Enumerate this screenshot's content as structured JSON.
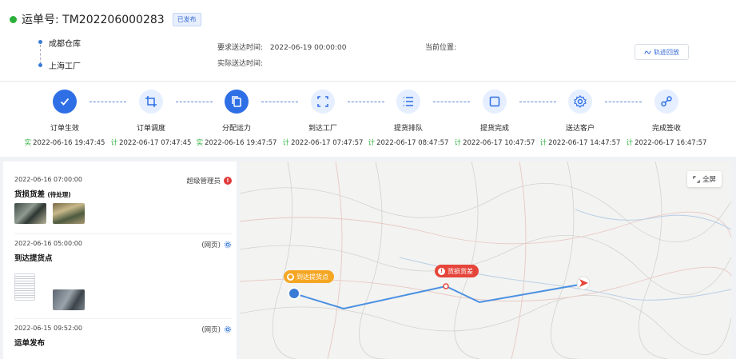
{
  "header": {
    "title": "运单号: TM202206000283",
    "status_badge": "已发布",
    "route": {
      "from": "成都仓库",
      "to": "上海工厂"
    },
    "required_time_label": "要求送达时间:",
    "required_time_value": "2022-06-19 00:00:00",
    "actual_time_label": "实际送达时间:",
    "actual_time_value": "",
    "location_label": "当前位置:",
    "location_value": "",
    "track_button": "轨迹回放"
  },
  "steps": [
    {
      "label": "订单生效",
      "prefix": "实",
      "time": "2022-06-16 19:47:45",
      "icon": "check-icon",
      "done": true
    },
    {
      "label": "订单调度",
      "prefix": "计",
      "time": "2022-06-17 07:47:45",
      "icon": "crop-icon",
      "done": false
    },
    {
      "label": "分配运力",
      "prefix": "实",
      "time": "2022-06-16 19:47:57",
      "icon": "copy-icon",
      "done": true
    },
    {
      "label": "到达工厂",
      "prefix": "计",
      "time": "2022-06-17 07:47:57",
      "icon": "scan-icon",
      "done": false
    },
    {
      "label": "提货排队",
      "prefix": "计",
      "time": "2022-06-17 08:47:57",
      "icon": "list-icon",
      "done": false
    },
    {
      "label": "提货完成",
      "prefix": "计",
      "time": "2022-06-17 10:47:57",
      "icon": "square-icon",
      "done": false
    },
    {
      "label": "送达客户",
      "prefix": "计",
      "time": "2022-06-17 14:47:57",
      "icon": "gear-icon",
      "done": false
    },
    {
      "label": "完成签收",
      "prefix": "计",
      "time": "2022-06-17 16:47:57",
      "icon": "share-icon",
      "done": false
    }
  ],
  "events": [
    {
      "time": "2022-06-16 07:00:00",
      "title": "货损货差",
      "title_note": "(待处理)",
      "user": "超级管理员"
    },
    {
      "time": "2022-06-16 05:00:00",
      "title": "到达提货点",
      "user": "(网页)"
    },
    {
      "time": "2022-06-15 09:52:00",
      "title": "运单发布",
      "user": "(网页)"
    }
  ],
  "map": {
    "fullscreen_label": "全屏",
    "tag_pickup": "到达提货点",
    "tag_damage": "货损货差",
    "tag_pickup_color": "#f5a623",
    "tag_damage_color": "#e5453b",
    "route_color": "#4a90e2"
  },
  "colors": {
    "accent": "#2f6fe6",
    "success": "#2bb03a",
    "danger": "#e03a3a"
  }
}
